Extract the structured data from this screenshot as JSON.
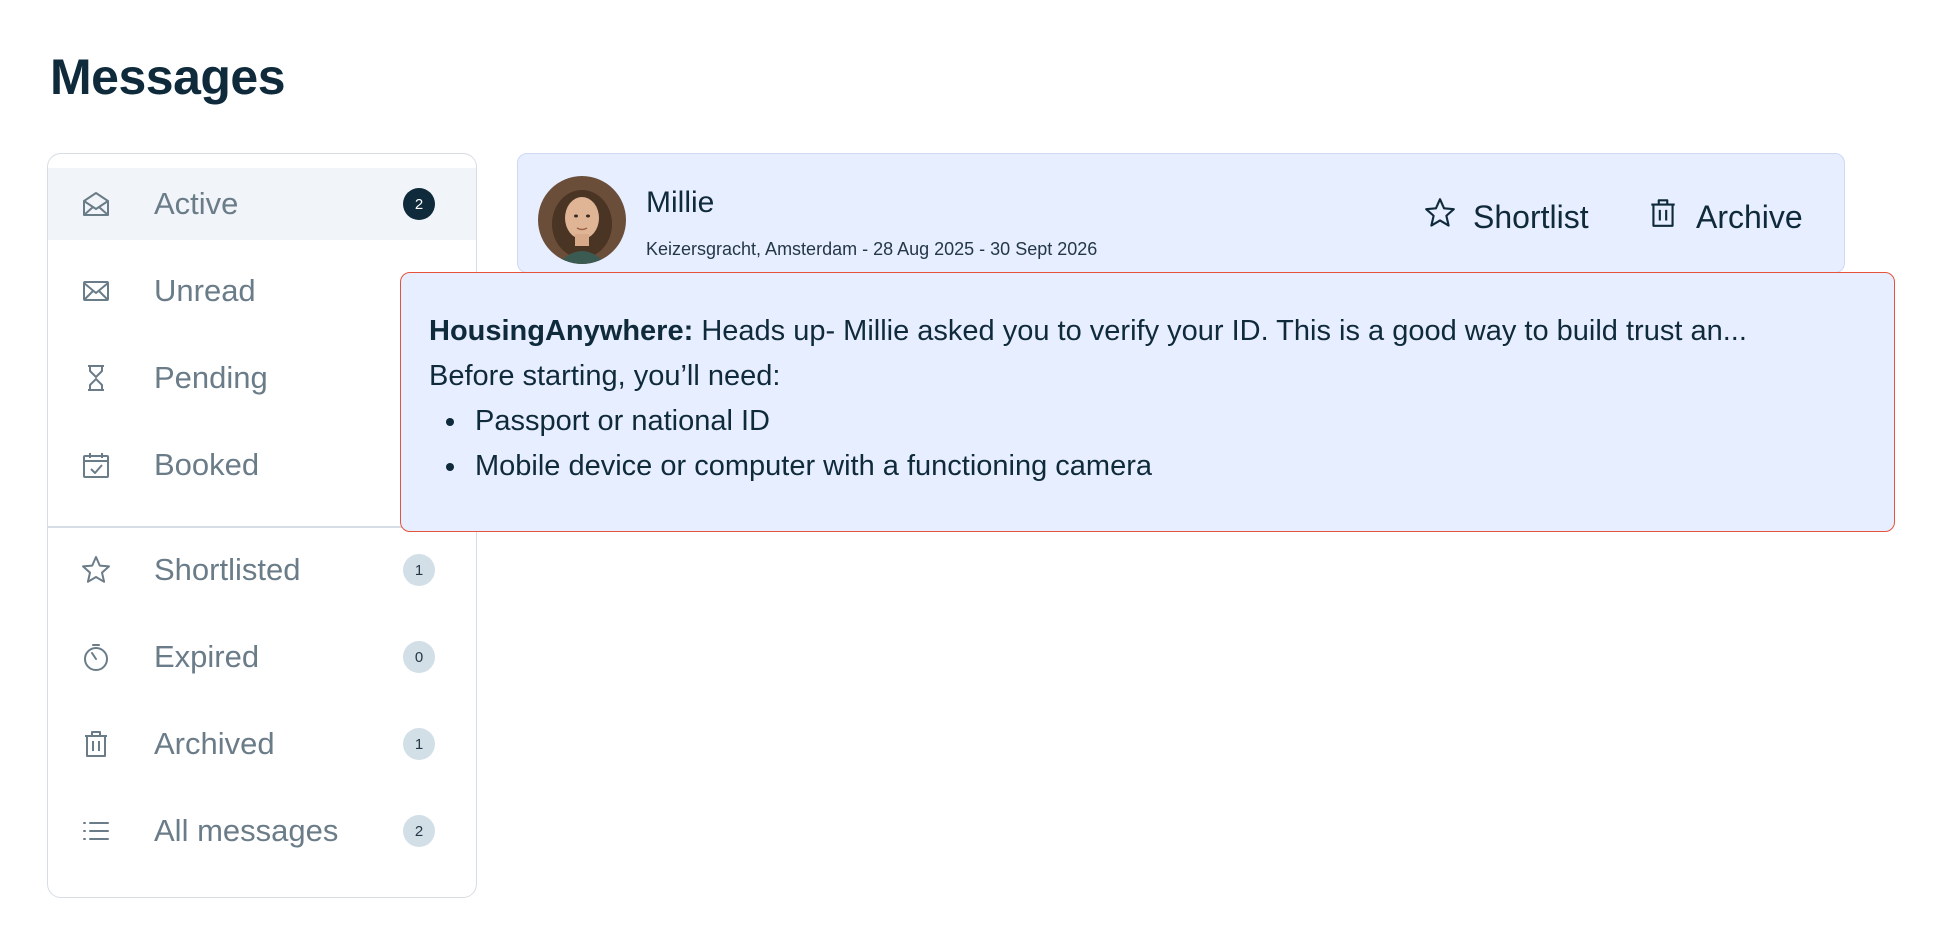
{
  "page": {
    "title": "Messages"
  },
  "sidebar": {
    "items": [
      {
        "label": "Active",
        "icon": "envelope-open-icon",
        "count": "2",
        "active": true
      },
      {
        "label": "Unread",
        "icon": "envelope-icon",
        "count": null
      },
      {
        "label": "Pending",
        "icon": "hourglass-icon",
        "count": null
      },
      {
        "label": "Booked",
        "icon": "calendar-check-icon",
        "count": null
      },
      {
        "label": "Shortlisted",
        "icon": "star-icon",
        "count": "1"
      },
      {
        "label": "Expired",
        "icon": "stopwatch-icon",
        "count": "0"
      },
      {
        "label": "Archived",
        "icon": "trash-icon",
        "count": "1"
      },
      {
        "label": "All messages",
        "icon": "list-icon",
        "count": "2"
      }
    ]
  },
  "conversation": {
    "name": "Millie",
    "subtitle": "Keizersgracht, Amsterdam - 28 Aug 2025 - 30 Sept 2026",
    "actions": {
      "shortlist": "Shortlist",
      "archive": "Archive"
    }
  },
  "notice": {
    "sender": "HousingAnywhere:",
    "text": "Heads up- Millie asked you to verify your ID. This is a good way to build trust an...",
    "intro": "Before starting, you’ll need:",
    "bullets": [
      "Passport or national ID",
      "Mobile device or computer with a functioning camera"
    ]
  },
  "colors": {
    "text_primary": "#0e2a3b",
    "text_muted": "#6b7c89",
    "card_bg": "#e7eeff",
    "notice_border": "#e5533d",
    "badge_dark": "#0e2a3b",
    "badge_light": "#d3dfe7"
  }
}
